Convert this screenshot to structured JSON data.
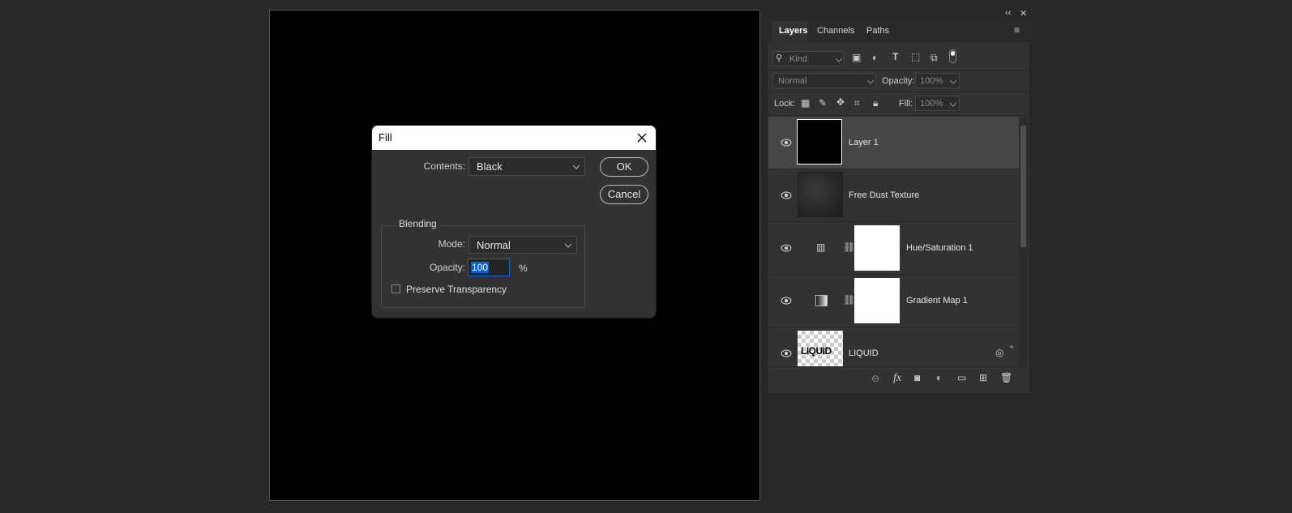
{
  "dialog": {
    "title": "Fill",
    "contents_label": "Contents:",
    "contents_value": "Black",
    "ok_label": "OK",
    "cancel_label": "Cancel",
    "blending_label": "Blending",
    "mode_label": "Mode:",
    "mode_value": "Normal",
    "opacity_label": "Opacity:",
    "opacity_value": "100",
    "percent": "%",
    "preserve_label": "Preserve Transparency"
  },
  "panel": {
    "tabs": [
      "Layers",
      "Channels",
      "Paths"
    ],
    "filter_kind": "Kind",
    "blend_mode": "Normal",
    "opacity_label": "Opacity:",
    "opacity_value": "100%",
    "lock_label": "Lock:",
    "fill_label": "Fill:",
    "fill_value": "100%",
    "fx_label": "fx",
    "layers": [
      {
        "name": "Layer 1"
      },
      {
        "name": "Free Dust Texture"
      },
      {
        "name": "Hue/Saturation 1"
      },
      {
        "name": "Gradient Map 1"
      },
      {
        "name": "LIQUID",
        "thumb_text": "LIQUID"
      }
    ]
  }
}
